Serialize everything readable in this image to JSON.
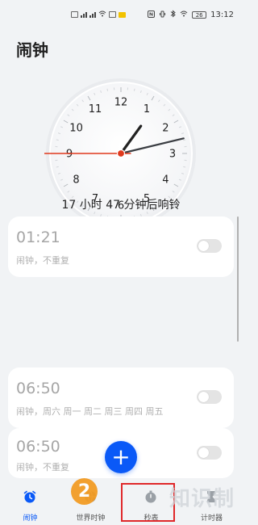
{
  "status_bar": {
    "time": "13:12",
    "battery": "26"
  },
  "title": "闹钟",
  "clock": {
    "numbers": [
      "12",
      "1",
      "2",
      "3",
      "4",
      "5",
      "6",
      "7",
      "8",
      "9",
      "10",
      "11"
    ],
    "hour": 1,
    "minute": 12,
    "second": 45,
    "colors": {
      "hands": "#222222",
      "second_hand": "#e0391d"
    }
  },
  "countdown": "17 小时 47 分钟后响铃",
  "alarms": [
    {
      "time": "01:21",
      "subtitle": "闹钟，不重复",
      "enabled": false
    },
    {
      "time": "06:50",
      "subtitle": "闹钟，周六 周一 周二 周三 周四 周五",
      "enabled": false
    },
    {
      "time": "06:50",
      "subtitle": "闹钟，不重复",
      "enabled": false
    }
  ],
  "fab_label": "+",
  "nav": [
    {
      "label": "闹钟",
      "icon": "alarm-clock-icon",
      "active": true
    },
    {
      "label": "世界时钟",
      "icon": "globe-icon",
      "active": false
    },
    {
      "label": "秒表",
      "icon": "stopwatch-icon",
      "active": false
    },
    {
      "label": "计时器",
      "icon": "timer-icon",
      "active": false
    }
  ],
  "overlay": {
    "badge": "2",
    "watermark": "知识制"
  },
  "accent_color": "#0a59f7"
}
